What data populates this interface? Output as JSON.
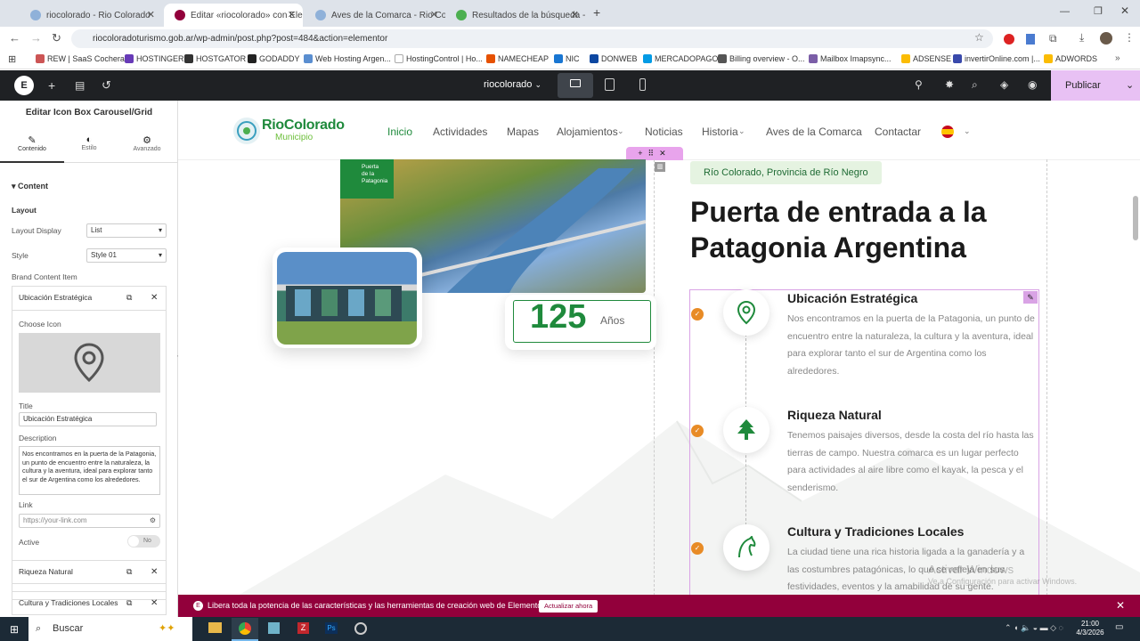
{
  "browser": {
    "tabs": [
      {
        "label": "riocolorado - Rio Colorado"
      },
      {
        "label": "Editar «riocolorado» con Eleme"
      },
      {
        "label": "Aves de la Comarca - Rio Colo"
      },
      {
        "label": "Resultados de la búsqueda - Go"
      }
    ],
    "url": "riocoloradoturismo.gob.ar/wp-admin/post.php?post=484&action=elementor",
    "bookmarks": [
      "REW | SaaS Cocheras",
      "HOSTINGER",
      "HOSTGATOR",
      "GODADDY",
      "Web Hosting Argen...",
      "HostingControl | Ho...",
      "NAMECHEAP",
      "NIC",
      "DONWEB",
      "MERCADOPAGO",
      "Billing overview - O...",
      "Mailbox Imapsync...",
      "ADSENSE",
      "invertirOnline.com |...",
      "ADWORDS"
    ]
  },
  "editor": {
    "site_name": "riocolorado",
    "publish_label": "Publicar"
  },
  "panel": {
    "title": "Editar Icon Box Carousel/Grid",
    "tabs": [
      "Contenido",
      "Estilo",
      "Avanzado"
    ],
    "section": "Content",
    "layout_heading": "Layout",
    "layout_display_label": "Layout Display",
    "layout_display_value": "List",
    "style_label": "Style",
    "style_value": "Style 01",
    "brand_content_label": "Brand Content Item",
    "items": [
      "Ubicación Estratégica",
      "Riqueza Natural",
      "Cultura y Tradiciones Locales"
    ],
    "choose_icon_label": "Choose Icon",
    "title_label": "Title",
    "title_value": "Ubicación Estratégica",
    "description_label": "Description",
    "description_value": "Nos encontramos en la puerta de la Patagonia, un punto de encuentro entre la naturaleza, la cultura y la aventura, ideal para explorar tanto el sur de Argentina como los alrededores.",
    "link_label": "Link",
    "link_placeholder": "https://your-link.com",
    "active_label": "Active",
    "active_value": "No"
  },
  "site": {
    "logo_main": "RioColorado",
    "logo_sub": "Municipio",
    "nav": [
      "Inicio",
      "Actividades",
      "Mapas",
      "Alojamientos",
      "Noticias",
      "Historia",
      "Aves de la Comarca",
      "Contactar"
    ],
    "badge": "Río Colorado, Provincia de Río Negro",
    "heading_line1": "Puerta de entrada a la",
    "heading_line2": "Patagonia Argentina",
    "years_number": "125",
    "years_label": "Años",
    "photo_tag_line1": "Puerta",
    "photo_tag_line2": "de la",
    "photo_tag_line3": "Patagonia",
    "features": [
      {
        "title": "Ubicación Estratégica",
        "desc": "Nos encontramos en la puerta de la Patagonia, un punto de encuentro entre la naturaleza, la cultura y la aventura, ideal para explorar tanto el sur de Argentina como los alrededores."
      },
      {
        "title": "Riqueza Natural",
        "desc": "Tenemos paisajes diversos, desde la costa del río hasta las tierras de campo. Nuestra comarca es un lugar perfecto para actividades al aire libre como el kayak, la pesca y el senderismo."
      },
      {
        "title": "Cultura y Tradiciones Locales",
        "desc": "La ciudad tiene una rica historia ligada a la ganadería y a las costumbres patagónicas, lo que se refleja en sus festividades, eventos y la amabilidad de su gente."
      }
    ],
    "watermark_line1": "Activar Windows",
    "watermark_line2": "Ve a Configuración para activar Windows."
  },
  "notice": {
    "text": "Libera toda la potencia de las características y las herramientas de creación web de Elementor.",
    "button": "Actualizar ahora"
  },
  "taskbar": {
    "search": "Buscar",
    "time": "21:00",
    "date": "4/3/2026"
  },
  "colors": {
    "accent_green": "#1f8a3c",
    "elementor_dark": "#1f2124",
    "publish": "#e8c1f4",
    "notice": "#92003b",
    "check": "#e88b26"
  }
}
